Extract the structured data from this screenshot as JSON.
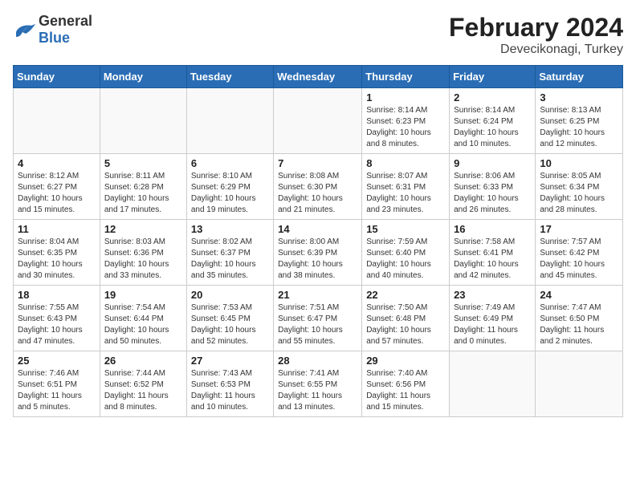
{
  "header": {
    "logo_general": "General",
    "logo_blue": "Blue",
    "title": "February 2024",
    "subtitle": "Devecikonagi, Turkey"
  },
  "days_of_week": [
    "Sunday",
    "Monday",
    "Tuesday",
    "Wednesday",
    "Thursday",
    "Friday",
    "Saturday"
  ],
  "weeks": [
    [
      {
        "day": "",
        "info": ""
      },
      {
        "day": "",
        "info": ""
      },
      {
        "day": "",
        "info": ""
      },
      {
        "day": "",
        "info": ""
      },
      {
        "day": "1",
        "info": "Sunrise: 8:14 AM\nSunset: 6:23 PM\nDaylight: 10 hours and 8 minutes."
      },
      {
        "day": "2",
        "info": "Sunrise: 8:14 AM\nSunset: 6:24 PM\nDaylight: 10 hours and 10 minutes."
      },
      {
        "day": "3",
        "info": "Sunrise: 8:13 AM\nSunset: 6:25 PM\nDaylight: 10 hours and 12 minutes."
      }
    ],
    [
      {
        "day": "4",
        "info": "Sunrise: 8:12 AM\nSunset: 6:27 PM\nDaylight: 10 hours and 15 minutes."
      },
      {
        "day": "5",
        "info": "Sunrise: 8:11 AM\nSunset: 6:28 PM\nDaylight: 10 hours and 17 minutes."
      },
      {
        "day": "6",
        "info": "Sunrise: 8:10 AM\nSunset: 6:29 PM\nDaylight: 10 hours and 19 minutes."
      },
      {
        "day": "7",
        "info": "Sunrise: 8:08 AM\nSunset: 6:30 PM\nDaylight: 10 hours and 21 minutes."
      },
      {
        "day": "8",
        "info": "Sunrise: 8:07 AM\nSunset: 6:31 PM\nDaylight: 10 hours and 23 minutes."
      },
      {
        "day": "9",
        "info": "Sunrise: 8:06 AM\nSunset: 6:33 PM\nDaylight: 10 hours and 26 minutes."
      },
      {
        "day": "10",
        "info": "Sunrise: 8:05 AM\nSunset: 6:34 PM\nDaylight: 10 hours and 28 minutes."
      }
    ],
    [
      {
        "day": "11",
        "info": "Sunrise: 8:04 AM\nSunset: 6:35 PM\nDaylight: 10 hours and 30 minutes."
      },
      {
        "day": "12",
        "info": "Sunrise: 8:03 AM\nSunset: 6:36 PM\nDaylight: 10 hours and 33 minutes."
      },
      {
        "day": "13",
        "info": "Sunrise: 8:02 AM\nSunset: 6:37 PM\nDaylight: 10 hours and 35 minutes."
      },
      {
        "day": "14",
        "info": "Sunrise: 8:00 AM\nSunset: 6:39 PM\nDaylight: 10 hours and 38 minutes."
      },
      {
        "day": "15",
        "info": "Sunrise: 7:59 AM\nSunset: 6:40 PM\nDaylight: 10 hours and 40 minutes."
      },
      {
        "day": "16",
        "info": "Sunrise: 7:58 AM\nSunset: 6:41 PM\nDaylight: 10 hours and 42 minutes."
      },
      {
        "day": "17",
        "info": "Sunrise: 7:57 AM\nSunset: 6:42 PM\nDaylight: 10 hours and 45 minutes."
      }
    ],
    [
      {
        "day": "18",
        "info": "Sunrise: 7:55 AM\nSunset: 6:43 PM\nDaylight: 10 hours and 47 minutes."
      },
      {
        "day": "19",
        "info": "Sunrise: 7:54 AM\nSunset: 6:44 PM\nDaylight: 10 hours and 50 minutes."
      },
      {
        "day": "20",
        "info": "Sunrise: 7:53 AM\nSunset: 6:45 PM\nDaylight: 10 hours and 52 minutes."
      },
      {
        "day": "21",
        "info": "Sunrise: 7:51 AM\nSunset: 6:47 PM\nDaylight: 10 hours and 55 minutes."
      },
      {
        "day": "22",
        "info": "Sunrise: 7:50 AM\nSunset: 6:48 PM\nDaylight: 10 hours and 57 minutes."
      },
      {
        "day": "23",
        "info": "Sunrise: 7:49 AM\nSunset: 6:49 PM\nDaylight: 11 hours and 0 minutes."
      },
      {
        "day": "24",
        "info": "Sunrise: 7:47 AM\nSunset: 6:50 PM\nDaylight: 11 hours and 2 minutes."
      }
    ],
    [
      {
        "day": "25",
        "info": "Sunrise: 7:46 AM\nSunset: 6:51 PM\nDaylight: 11 hours and 5 minutes."
      },
      {
        "day": "26",
        "info": "Sunrise: 7:44 AM\nSunset: 6:52 PM\nDaylight: 11 hours and 8 minutes."
      },
      {
        "day": "27",
        "info": "Sunrise: 7:43 AM\nSunset: 6:53 PM\nDaylight: 11 hours and 10 minutes."
      },
      {
        "day": "28",
        "info": "Sunrise: 7:41 AM\nSunset: 6:55 PM\nDaylight: 11 hours and 13 minutes."
      },
      {
        "day": "29",
        "info": "Sunrise: 7:40 AM\nSunset: 6:56 PM\nDaylight: 11 hours and 15 minutes."
      },
      {
        "day": "",
        "info": ""
      },
      {
        "day": "",
        "info": ""
      }
    ]
  ]
}
